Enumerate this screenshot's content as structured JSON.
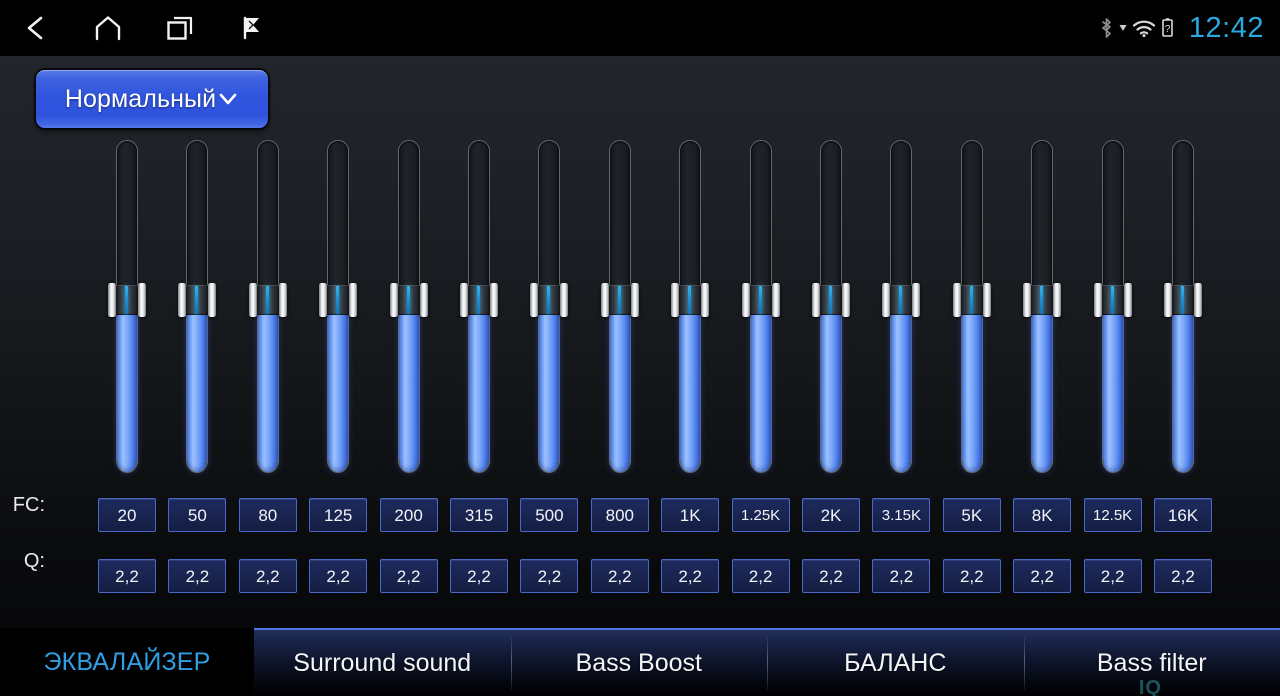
{
  "statusbar": {
    "nav": [
      {
        "name": "back-icon",
        "label": "Back"
      },
      {
        "name": "home-icon",
        "label": "Home"
      },
      {
        "name": "recents-icon",
        "label": "Recent apps"
      },
      {
        "name": "flag-icon",
        "label": "Flag"
      }
    ],
    "icons": [
      {
        "name": "bluetooth-icon",
        "label": "Bluetooth"
      },
      {
        "name": "signal-icon",
        "label": "Signal"
      },
      {
        "name": "wifi-icon",
        "label": "Wi-Fi"
      },
      {
        "name": "battery-unknown-icon",
        "label": "Battery unknown"
      }
    ],
    "clock": "12:42"
  },
  "preset": {
    "label": "Нормальный",
    "chevron": "chevron-down-icon"
  },
  "equalizer": {
    "fc_row_label": "FC:",
    "q_row_label": "Q:",
    "bands": [
      {
        "fc": "20",
        "q": "2,2",
        "value": 50
      },
      {
        "fc": "50",
        "q": "2,2",
        "value": 50
      },
      {
        "fc": "80",
        "q": "2,2",
        "value": 50
      },
      {
        "fc": "125",
        "q": "2,2",
        "value": 50
      },
      {
        "fc": "200",
        "q": "2,2",
        "value": 50
      },
      {
        "fc": "315",
        "q": "2,2",
        "value": 50
      },
      {
        "fc": "500",
        "q": "2,2",
        "value": 50
      },
      {
        "fc": "800",
        "q": "2,2",
        "value": 50
      },
      {
        "fc": "1K",
        "q": "2,2",
        "value": 50
      },
      {
        "fc": "1.25K",
        "q": "2,2",
        "value": 50
      },
      {
        "fc": "2K",
        "q": "2,2",
        "value": 50
      },
      {
        "fc": "3.15K",
        "q": "2,2",
        "value": 50
      },
      {
        "fc": "5K",
        "q": "2,2",
        "value": 50
      },
      {
        "fc": "8K",
        "q": "2,2",
        "value": 50
      },
      {
        "fc": "12.5K",
        "q": "2,2",
        "value": 50
      },
      {
        "fc": "16K",
        "q": "2,2",
        "value": 50
      }
    ]
  },
  "tabs": {
    "active_index": 0,
    "items": [
      {
        "label": "ЭКВАЛАЙЗЕР",
        "active": true
      },
      {
        "label": "Surround sound",
        "active": false
      },
      {
        "label": "Bass Boost",
        "active": false
      },
      {
        "label": "БАЛАНС",
        "active": false
      },
      {
        "label": "Bass filter",
        "active": false
      }
    ]
  },
  "watermark": "IQ",
  "colors": {
    "accent_blue": "#2f9fe4",
    "clock_blue": "#2aa9e0",
    "slider_fill": "#6b9bf5",
    "box_border": "#4a67c8",
    "box_fill": "#19244f",
    "tab_top_border": "#4e7ae8"
  }
}
